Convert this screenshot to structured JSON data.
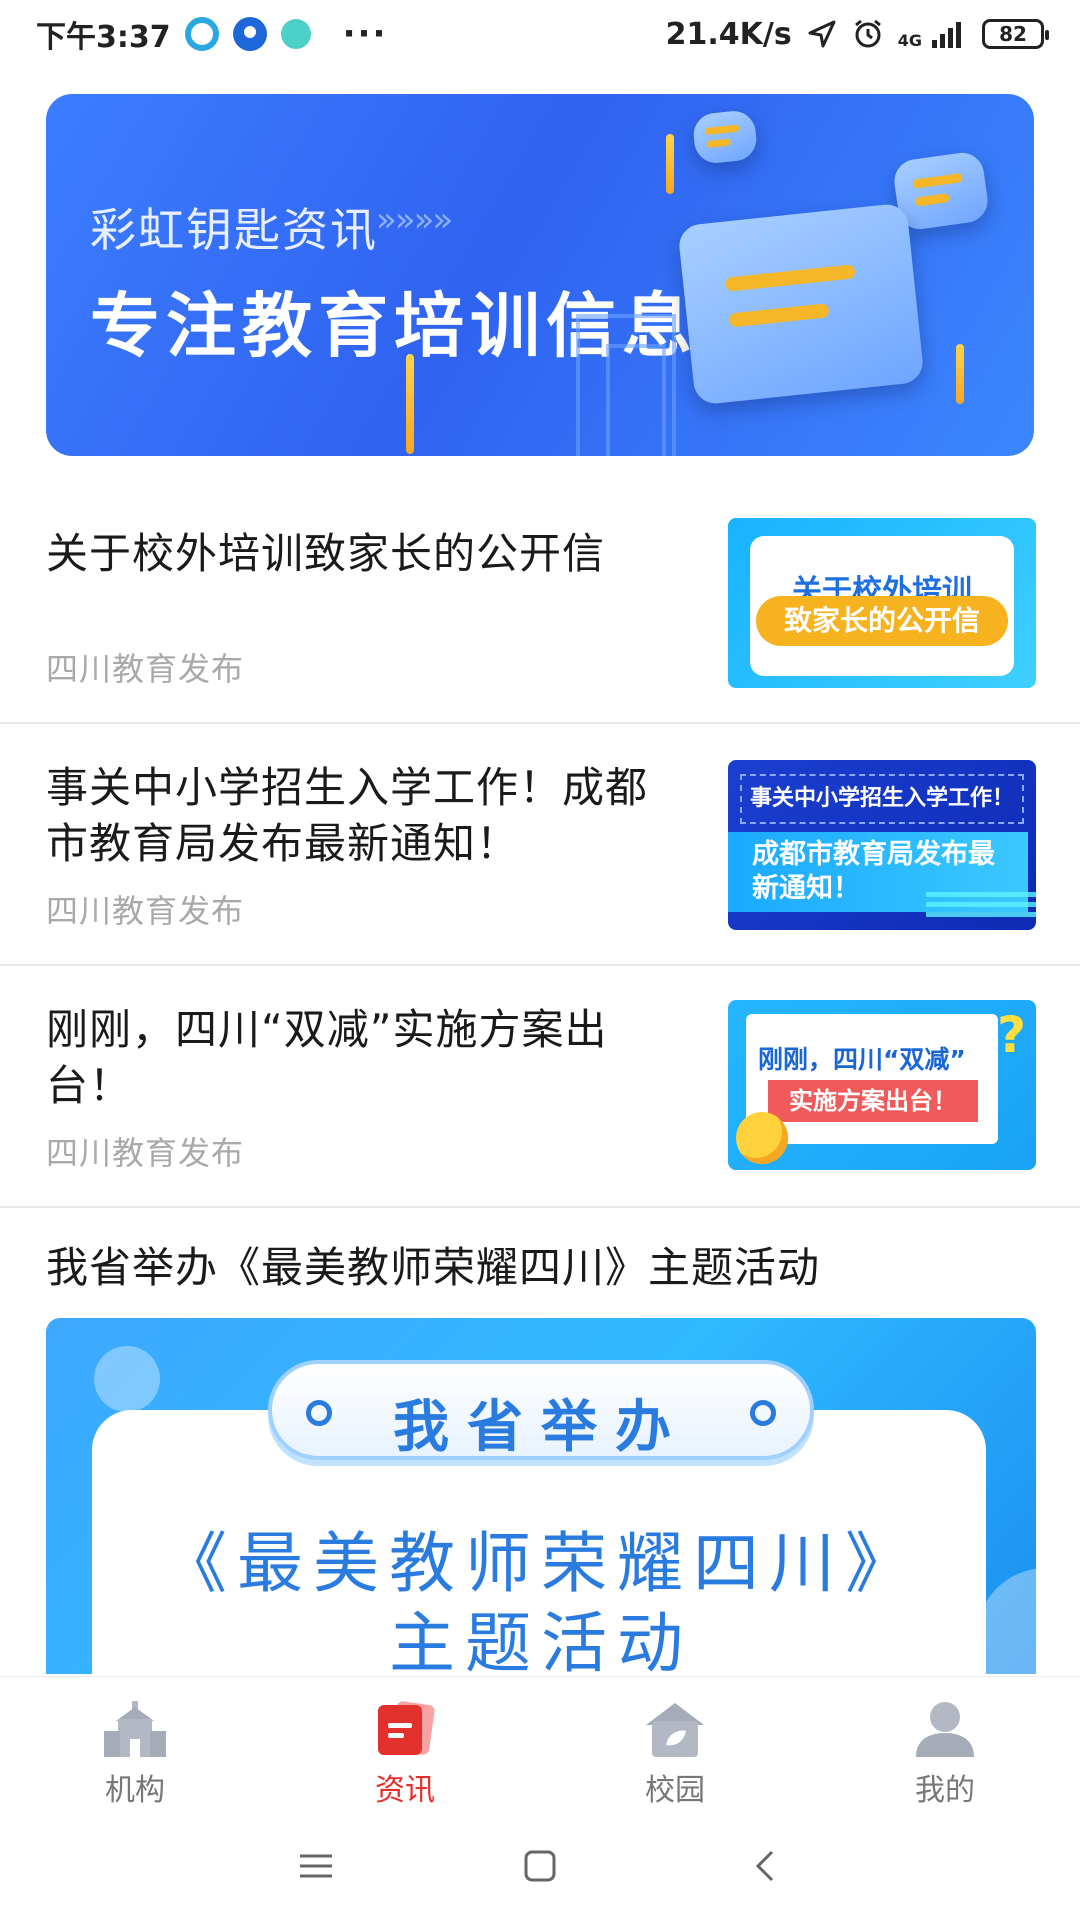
{
  "status_bar": {
    "time": "下午3:37",
    "more": "···",
    "network_speed": "21.4K/s",
    "signal_label": "4G",
    "battery": "82"
  },
  "banner": {
    "subtitle": "彩虹钥匙资讯",
    "arrows": "»»»»",
    "title": "专注教育培训信息"
  },
  "news": [
    {
      "title": "关于校外培训致家长的公开信",
      "source": "四川教育发布",
      "thumb_line1": "关于校外培训",
      "thumb_line2": "致家长的公开信"
    },
    {
      "title": "事关中小学招生入学工作！成都市教育局发布最新通知！",
      "source": "四川教育发布",
      "thumb_line1": "事关中小学招生入学工作！",
      "thumb_line2": "成都市教育局发布最新通知！"
    },
    {
      "title": "刚刚，四川“双减”实施方案出台！",
      "source": "四川教育发布",
      "thumb_line1": "刚刚，四川“双减”",
      "thumb_line2": "实施方案出台！"
    }
  ],
  "featured": {
    "title": "我省举办《最美教师荣耀四川》主题活动",
    "pill": "我省举办",
    "line1": "《最美教师荣耀四川》",
    "line2": "主题活动"
  },
  "bottom_nav": [
    {
      "label": "机构",
      "icon": "building-icon"
    },
    {
      "label": "资讯",
      "icon": "news-icon",
      "active": true
    },
    {
      "label": "校园",
      "icon": "campus-icon"
    },
    {
      "label": "我的",
      "icon": "user-icon"
    }
  ],
  "colors": {
    "accent": "#e2302c",
    "banner_blue": "#2f63f0",
    "source_gray": "#a9a9a9"
  }
}
